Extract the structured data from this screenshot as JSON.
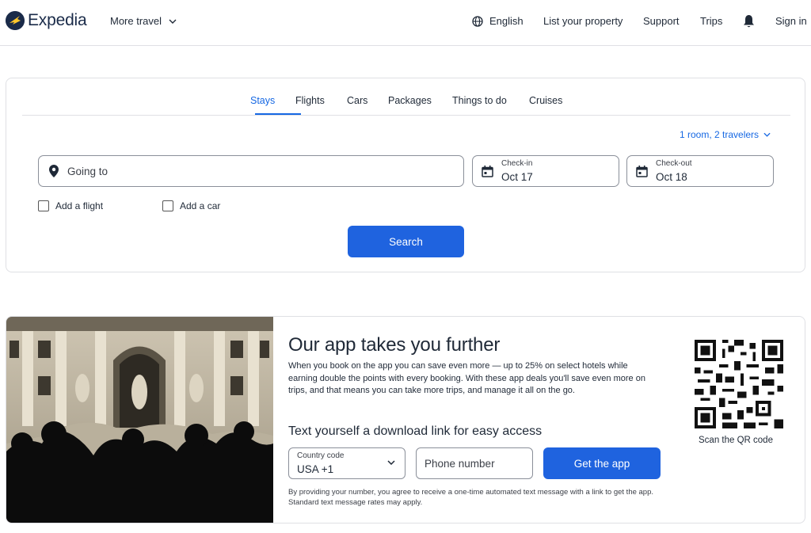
{
  "header": {
    "brand": "Expedia",
    "more_travel": "More travel",
    "language": "English",
    "list_property": "List your property",
    "support": "Support",
    "trips": "Trips",
    "sign_in": "Sign in"
  },
  "search": {
    "tabs": [
      {
        "label": "Stays",
        "active": true
      },
      {
        "label": "Flights",
        "active": false
      },
      {
        "label": "Cars",
        "active": false
      },
      {
        "label": "Packages",
        "active": false
      },
      {
        "label": "Things to do",
        "active": false
      },
      {
        "label": "Cruises",
        "active": false
      }
    ],
    "travelers": "1 room, 2 travelers",
    "destination_placeholder": "Going to",
    "checkin_label": "Check-in",
    "checkin_value": "Oct 17",
    "checkout_label": "Check-out",
    "checkout_value": "Oct 18",
    "add_flight": "Add a flight",
    "add_car": "Add a car",
    "search_button": "Search"
  },
  "app_promo": {
    "title": "Our app takes you further",
    "description": "When you book on the app you can save even more — up to 25% on select hotels while earning double the points with every booking. With these app deals you'll save even more on trips, and that means you can take more trips, and manage it all on the go.",
    "subtitle": "Text yourself a download link for easy access",
    "country_label": "Country code",
    "country_value": "USA +1",
    "phone_placeholder": "Phone number",
    "get_app_button": "Get the app",
    "disclaimer": "By providing your number, you agree to receive a one-time automated text message with a link to get the app. Standard text message rates may apply.",
    "qr_label": "Scan the QR code"
  },
  "colors": {
    "accent": "#1668e3",
    "button": "#1f63df",
    "brand": "#1a2b49"
  },
  "icons": [
    "expedia-logo-icon",
    "chevron-down-icon",
    "globe-icon",
    "bell-icon",
    "location-pin-icon",
    "calendar-icon",
    "qr-code-icon"
  ]
}
